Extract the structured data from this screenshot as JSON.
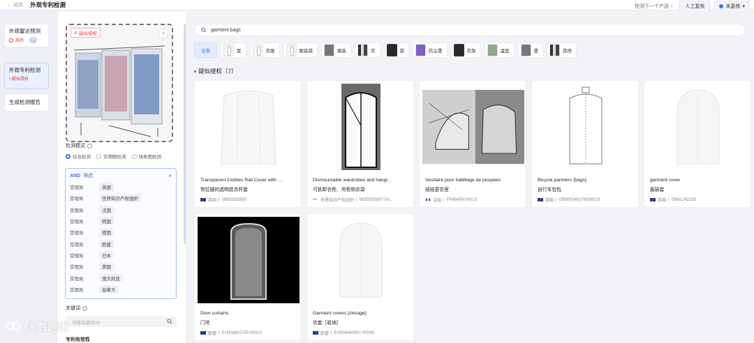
{
  "topbar": {
    "back_label": "返回",
    "title": "外观专利检测",
    "next_label": "检测下一个产品",
    "manual_label": "人工复核",
    "status_label": "未复核"
  },
  "nav": {
    "items": [
      {
        "label": "外观雷达预测",
        "risk": "风险",
        "pill": "4"
      },
      {
        "label": "外观专利检测",
        "sub": "• 疑似侵权"
      },
      {
        "label": "生成检测报告"
      }
    ]
  },
  "preview": {
    "tag": "疑似侵权"
  },
  "mode": {
    "label": "检测模式",
    "options": [
      "综合检测",
      "实物图检测",
      "线条图检测"
    ],
    "selected": "综合检测"
  },
  "filter": {
    "and": "AND",
    "title": "筛选",
    "rows": [
      {
        "key": "受理局",
        "value": "英国"
      },
      {
        "key": "受理局",
        "value": "世界知识产权组织"
      },
      {
        "key": "受理局",
        "value": "法国"
      },
      {
        "key": "受理局",
        "value": "韩国"
      },
      {
        "key": "受理局",
        "value": "德国"
      },
      {
        "key": "受理局",
        "value": "欧盟"
      },
      {
        "key": "受理局",
        "value": "日本"
      },
      {
        "key": "受理局",
        "value": "美国"
      },
      {
        "key": "受理局",
        "value": "澳大利亚"
      },
      {
        "key": "受理局",
        "value": "加拿大"
      }
    ]
  },
  "keywords": {
    "label": "关键词",
    "placeholder": "可搜关键词/ID"
  },
  "validity": {
    "label": "专利有效性"
  },
  "search": {
    "query": "garment bags"
  },
  "categories": [
    {
      "label": "全部"
    },
    {
      "label": "套",
      "thumb": "white"
    },
    {
      "label": "衣服",
      "thumb": "white"
    },
    {
      "label": "服装袋",
      "thumb": "white"
    },
    {
      "label": "服装",
      "thumb": "grey"
    },
    {
      "label": "衣",
      "thumb": "bw"
    },
    {
      "label": "袋",
      "thumb": "dark"
    },
    {
      "label": "防尘罩",
      "thumb": "purple"
    },
    {
      "label": "衣架",
      "thumb": "dark"
    },
    {
      "label": "温室",
      "thumb": "green"
    },
    {
      "label": "罩",
      "thumb": "grey"
    },
    {
      "label": "其他",
      "thumb": "bw"
    }
  ],
  "results": {
    "title": "疑似侵权（7）",
    "cards": [
      {
        "title_en": "Transparent Clothes Rail Cover with ...",
        "title_cn": "带拉链的透明挂衣杆套",
        "office": "英国",
        "id": "GB63329355",
        "flag": "gb"
      },
      {
        "title_en": "Dismountable wardrobes and hangi...",
        "title_cn": "可拆卸衣柜、吊柜和衣袋",
        "office": "世界知识产权组织",
        "id": "WOD050857-00...",
        "flag": "wipo"
      },
      {
        "title_en": "Vestiaire pour habillage de poupées",
        "title_cn": "娃娃更衣室",
        "office": "法国",
        "id": "FR45459-0001S",
        "flag": "fr"
      },
      {
        "title_en": "Bicycle panniers [bags]",
        "title_cn": "自行车包包",
        "office": "英国",
        "id": "GB900345376000015",
        "flag": "gb"
      },
      {
        "title_en": "garment cover",
        "title_cn": "服装套",
        "office": "英国",
        "id": "GB61242235",
        "flag": "gb"
      },
      {
        "title_en": "Door curtains",
        "title_cn": "门帘",
        "office": "欧盟",
        "id": "EU008803795-0002S",
        "flag": "eu"
      },
      {
        "title_en": "Garment covers [storage]",
        "title_cn": "衣套［收纳］",
        "office": "欧盟",
        "id": "EU008460497-0003S",
        "flag": "eu"
      }
    ]
  },
  "watermark": "大数跨境"
}
